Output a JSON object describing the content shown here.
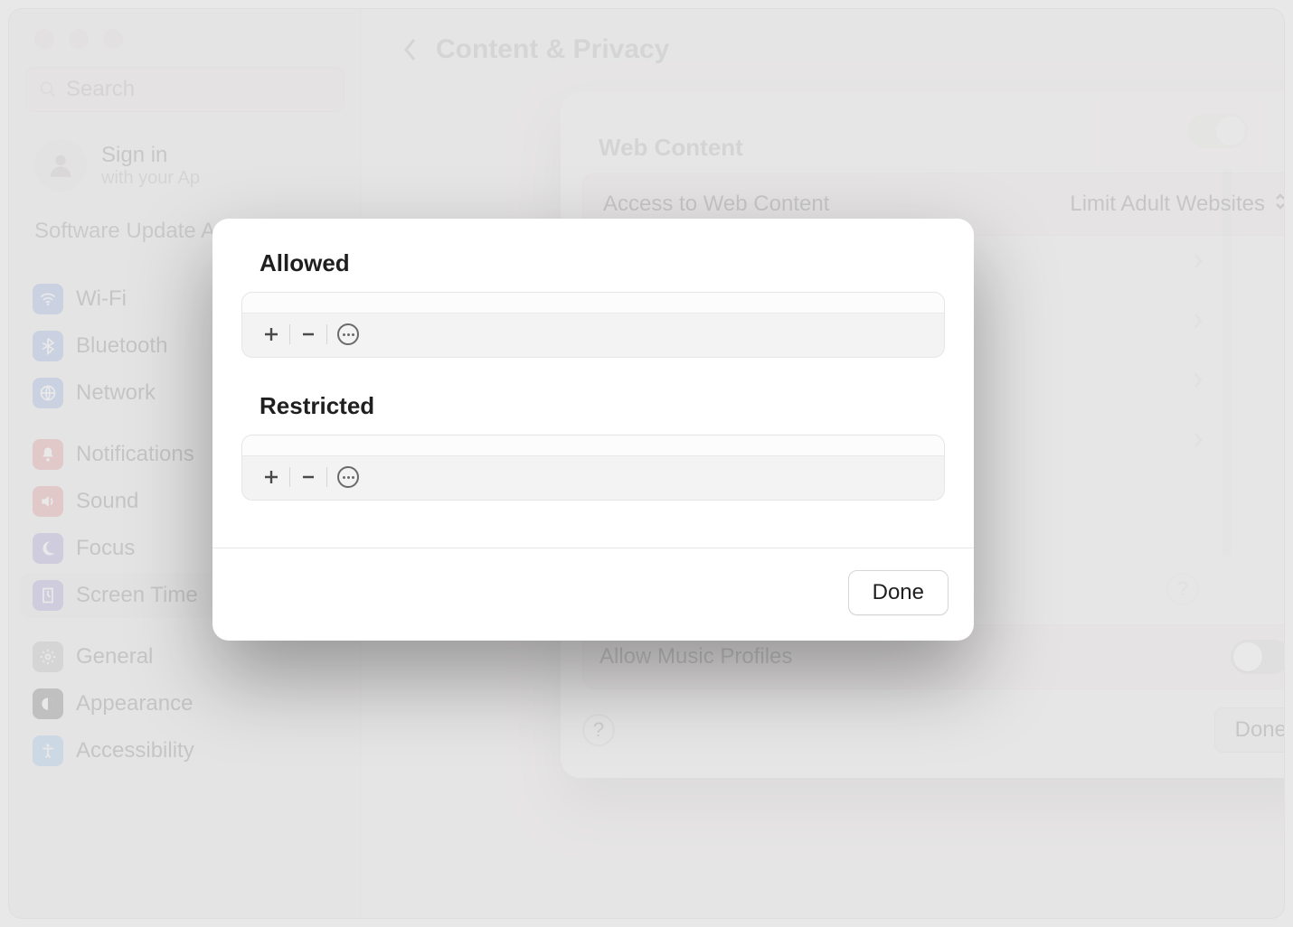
{
  "header": {
    "title": "Content & Privacy"
  },
  "search": {
    "placeholder": "Search"
  },
  "account": {
    "signin": "Sign in",
    "subtitle": "with your Ap"
  },
  "update_note": "Software Update Available",
  "sidebar": {
    "items": [
      {
        "label": "Wi-Fi",
        "icon": "wifi",
        "color": "ico-blue"
      },
      {
        "label": "Bluetooth",
        "icon": "bluetooth",
        "color": "ico-blue"
      },
      {
        "label": "Network",
        "icon": "network",
        "color": "ico-blue"
      },
      {
        "label": "Notifications",
        "icon": "bell",
        "color": "ico-red"
      },
      {
        "label": "Sound",
        "icon": "sound",
        "color": "ico-red"
      },
      {
        "label": "Focus",
        "icon": "focus",
        "color": "ico-indigo"
      },
      {
        "label": "Screen Time",
        "icon": "screentime",
        "color": "ico-indigo",
        "selected": true
      },
      {
        "label": "General",
        "icon": "general",
        "color": "ico-gray"
      },
      {
        "label": "Appearance",
        "icon": "appearance",
        "color": "ico-black"
      },
      {
        "label": "Accessibility",
        "icon": "accessibility",
        "color": "ico-lightblue"
      }
    ]
  },
  "sheet": {
    "section_label": "Web Content",
    "access_label": "Access to Web Content",
    "access_value": "Limit Adult Websites",
    "allow_music_label": "Allow Music Profiles",
    "done_label": "Done"
  },
  "modal": {
    "allowed_title": "Allowed",
    "restricted_title": "Restricted",
    "done_label": "Done"
  }
}
